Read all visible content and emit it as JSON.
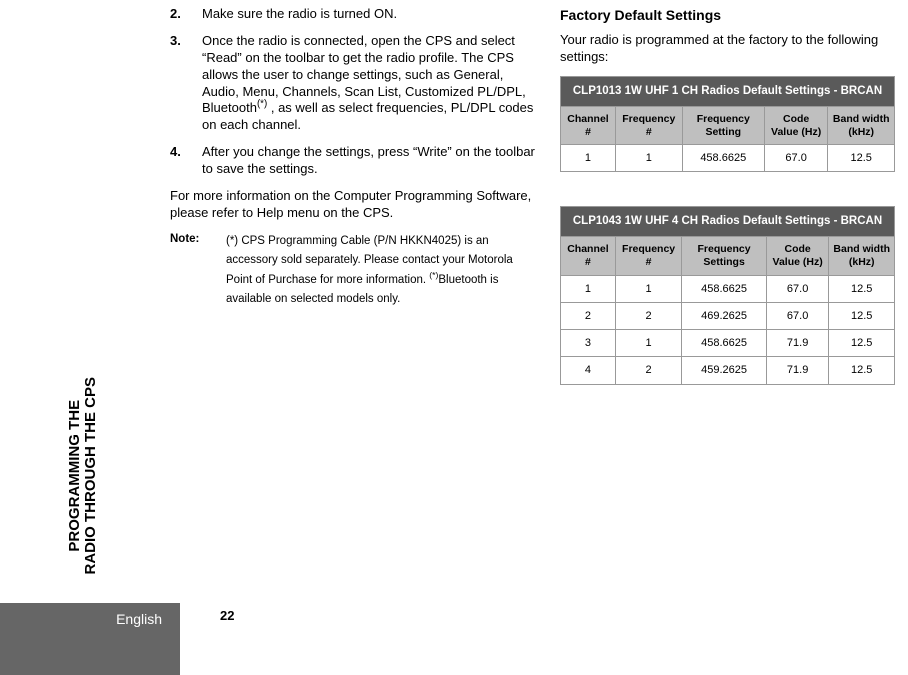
{
  "side_tab": "PROGRAMMING THE\nRADIO THROUGH THE CPS",
  "language": "English",
  "page_number": "22",
  "left": {
    "steps": [
      {
        "num": "2.",
        "text": "Make sure the radio is turned ON."
      },
      {
        "num": "3.",
        "text": "Once the radio is connected, open the CPS and select “Read” on the toolbar to get the radio profile. The CPS allows the user to change settings, such as General, Audio, Menu, Channels, Scan List, Customized PL/DPL, Bluetooth",
        "sup_after": "(*)",
        "text_after": " , as well as select frequencies, PL/DPL codes on each channel."
      },
      {
        "num": "4.",
        "text": "After you change the settings, press “Write” on the toolbar to save the settings."
      }
    ],
    "para": "For more information on the Computer Programming Software, please refer to Help menu on the CPS.",
    "note_label": "Note:",
    "note_text_1": "(*) CPS Programming Cable (P/N HKKN4025) is an accessory sold separately. Please contact your Motorola Point of Purchase for more information. ",
    "note_sup": "(*)",
    "note_text_2": "Bluetooth is available on selected models only."
  },
  "right": {
    "heading": "Factory Default Settings",
    "intro": "Your radio is programmed at the factory to the following settings:",
    "table1": {
      "title": "CLP1013 1W UHF 1 CH Radios Default Settings - BRCAN",
      "cols": [
        "Channel #",
        "Frequency #",
        "Frequency Setting",
        "Code Value (Hz)",
        "Band width (kHz)"
      ],
      "rows": [
        [
          "1",
          "1",
          "458.6625",
          "67.0",
          "12.5"
        ]
      ]
    },
    "table2": {
      "title": "CLP1043  1W UHF 4 CH Radios Default Settings - BRCAN",
      "cols": [
        "Channel #",
        "Frequency #",
        "Frequency Settings",
        "Code Value (Hz)",
        "Band width (kHz)"
      ],
      "rows": [
        [
          "1",
          "1",
          "458.6625",
          "67.0",
          "12.5"
        ],
        [
          "2",
          "2",
          "469.2625",
          "67.0",
          "12.5"
        ],
        [
          "3",
          "1",
          "458.6625",
          "71.9",
          "12.5"
        ],
        [
          "4",
          "2",
          "459.2625",
          "71.9",
          "12.5"
        ]
      ]
    }
  }
}
